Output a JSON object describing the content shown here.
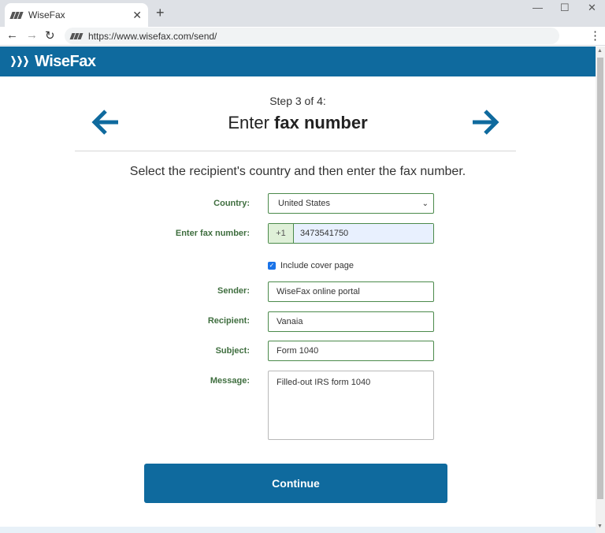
{
  "browser": {
    "tab_title": "WiseFax",
    "tab_close": "✕",
    "new_tab": "+",
    "url": "https://www.wisefax.com/send/",
    "icons": [
      "back-icon",
      "forward-icon",
      "reload-icon",
      "menu-icon",
      "minimize-icon",
      "maximize-icon",
      "close-icon"
    ]
  },
  "header": {
    "logo_text": "WiseFax",
    "brand_color": "#0f6a9e"
  },
  "step": {
    "label": "Step 3 of 4:",
    "title_prefix": "Enter ",
    "title_bold": "fax number"
  },
  "instructions": "Select the recipient's country and then enter the fax number.",
  "form": {
    "country_label": "Country:",
    "country_value": "United States",
    "fax_label": "Enter fax number:",
    "fax_code": "+1",
    "fax_value": "3473541750",
    "cover_page_label": "Include cover page",
    "cover_page_checked": true,
    "sender_label": "Sender:",
    "sender_value": "WiseFax online portal",
    "recipient_label": "Recipient:",
    "recipient_value": "Vanaia",
    "subject_label": "Subject:",
    "subject_value": "Form 1040",
    "message_label": "Message:",
    "message_value": "Filled-out IRS form 1040",
    "label_color": "#3f6e3f"
  },
  "continue_label": "Continue"
}
